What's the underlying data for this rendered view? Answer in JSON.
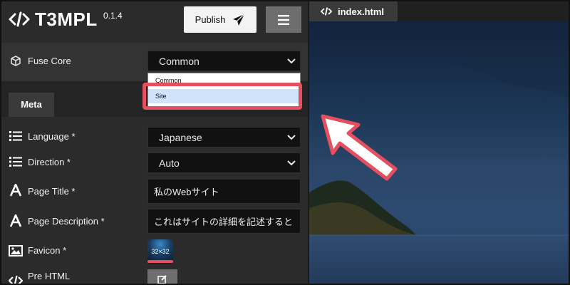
{
  "app": {
    "title": "T3MPL",
    "version": "0.1.4"
  },
  "header": {
    "publish_label": "Publish"
  },
  "fuse_core": {
    "label": "Fuse Core",
    "selected": "Common",
    "options": [
      "Common",
      "Site"
    ],
    "highlighted_option": "Site"
  },
  "tabs": [
    {
      "label": "Meta"
    }
  ],
  "fields": {
    "language": {
      "label": "Language *",
      "value": "Japanese"
    },
    "direction": {
      "label": "Direction *",
      "value": "Auto"
    },
    "page_title": {
      "label": "Page Title *",
      "value": "私のWebサイト"
    },
    "page_description": {
      "label": "Page Description *",
      "value": "これはサイトの詳細を記述すると"
    },
    "favicon": {
      "label": "Favicon *",
      "value": "32×32"
    },
    "pre_html": {
      "label": "Pre HTML"
    }
  },
  "preview": {
    "tab_label": "index.html"
  },
  "icons": {
    "logo": "code-icon",
    "publish": "send-icon",
    "menu": "menu-icon",
    "fuse_core": "cube-icon",
    "language": "list-icon",
    "direction": "list-icon",
    "page_title": "font-icon",
    "page_description": "font-icon",
    "favicon": "image-icon",
    "pre_html": "code-icon",
    "edit": "edit-icon"
  },
  "colors": {
    "accent": "#e54f5f",
    "panel": "#2b2b2b",
    "input": "#111111",
    "selected_option": "#cfe3fb"
  }
}
